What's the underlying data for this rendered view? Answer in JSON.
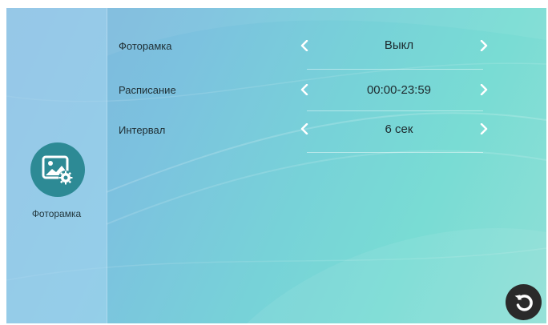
{
  "sidebar": {
    "icon": "photo-frame-settings-icon",
    "label": "Фоторамка"
  },
  "settings": [
    {
      "label": "Фоторамка",
      "value": "Выкл"
    },
    {
      "label": "Расписание",
      "value": "00:00-23:59"
    },
    {
      "label": "Интервал",
      "value": "6 сек"
    }
  ],
  "back_button": {
    "icon": "back-arrow-icon"
  },
  "colors": {
    "accent": "#2d8a95",
    "back_button": "#2a2a2a",
    "text": "#1f2e33",
    "arrow": "#ffffff"
  }
}
